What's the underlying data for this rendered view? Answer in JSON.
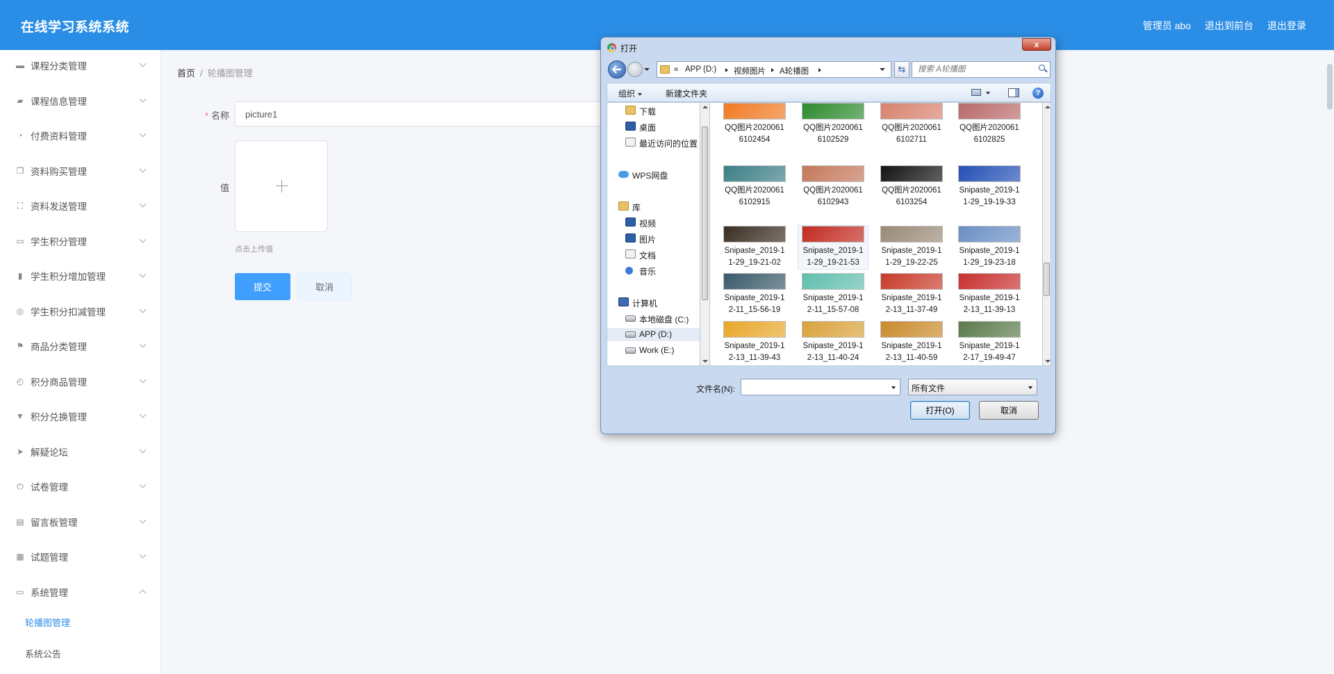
{
  "header": {
    "app_title": "在线学习系统系统",
    "user_label": "管理员 abo",
    "back_to_front": "退出到前台",
    "logout": "退出登录"
  },
  "sidebar": {
    "items": [
      {
        "label": "课程分类管理",
        "icon": "comment-icon"
      },
      {
        "label": "课程信息管理",
        "icon": "thumbs-up-icon"
      },
      {
        "label": "付费资料管理",
        "icon": "dashboard-icon"
      },
      {
        "label": "资料购买管理",
        "icon": "copy-icon"
      },
      {
        "label": "资料发送管理",
        "icon": "fullscreen-icon"
      },
      {
        "label": "学生积分管理",
        "icon": "id-card-icon"
      },
      {
        "label": "学生积分增加管理",
        "icon": "microphone-icon"
      },
      {
        "label": "学生积分扣减管理",
        "icon": "life-ring-icon"
      },
      {
        "label": "商品分类管理",
        "icon": "flag-icon"
      },
      {
        "label": "积分商品管理",
        "icon": "compass-icon"
      },
      {
        "label": "积分兑换管理",
        "icon": "thumbs-down-icon"
      },
      {
        "label": "解疑论坛",
        "icon": "paper-plane-icon"
      },
      {
        "label": "试卷管理",
        "icon": "power-icon"
      },
      {
        "label": "留言板管理",
        "icon": "clipboard-icon"
      },
      {
        "label": "试题管理",
        "icon": "grid-icon"
      },
      {
        "label": "系统管理",
        "icon": "message-icon"
      }
    ],
    "sub_items": [
      "轮播图管理",
      "系统公告"
    ]
  },
  "breadcrumb": {
    "home": "首页",
    "separator": "/",
    "current": "轮播图管理"
  },
  "form": {
    "name_required": "*",
    "name_label": "名称",
    "name_value": "picture1",
    "value_label": "值",
    "upload_hint": "点击上传值",
    "submit": "提交",
    "cancel": "取消"
  },
  "dialog": {
    "title": "打开",
    "close_label": "x",
    "address": {
      "overflow": "«",
      "segments": [
        "APP (D:)",
        "视频图片",
        "A轮播图"
      ]
    },
    "search_placeholder": "搜索 A轮播图",
    "organize": "组织",
    "new_folder": "新建文件夹",
    "help": "?",
    "nav_items": [
      {
        "label": "下载",
        "icon": "ni-folder"
      },
      {
        "label": "桌面",
        "icon": "ni-blue"
      },
      {
        "label": "最近访问的位置",
        "icon": "ni-doc"
      },
      {
        "label": "WPS网盘",
        "icon": "ni-cloud"
      },
      {
        "label": "库",
        "icon": "ni-lib"
      },
      {
        "label": "视频",
        "icon": "ni-blue"
      },
      {
        "label": "图片",
        "icon": "ni-blue"
      },
      {
        "label": "文档",
        "icon": "ni-doc"
      },
      {
        "label": "音乐",
        "icon": "ni-music"
      },
      {
        "label": "计算机",
        "icon": "ni-pc"
      },
      {
        "label": "本地磁盘 (C:)",
        "icon": "ni-drive"
      },
      {
        "label": "APP (D:)",
        "icon": "ni-drive"
      },
      {
        "label": "Work (E:)",
        "icon": "ni-drive"
      }
    ],
    "files": [
      {
        "name": "QQ图片20200616102454",
        "color": "#f07a23"
      },
      {
        "name": "QQ图片20200616102529",
        "color": "#2e8b2e"
      },
      {
        "name": "QQ图片20200616102711",
        "color": "#d7826e"
      },
      {
        "name": "QQ图片20200616102825",
        "color": "#b86a6a"
      },
      {
        "name": "QQ图片20200616102915",
        "color": "#3c7e86"
      },
      {
        "name": "QQ图片20200616102943",
        "color": "#c4785a"
      },
      {
        "name": "QQ图片20200616103254",
        "color": "#121212"
      },
      {
        "name": "Snipaste_2019-11-29_19-19-33",
        "color": "#2350b5"
      },
      {
        "name": "Snipaste_2019-11-29_19-21-02",
        "color": "#3a2e22"
      },
      {
        "name": "Snipaste_2019-11-29_19-21-53",
        "color": "#c22a20"
      },
      {
        "name": "Snipaste_2019-11-29_19-22-25",
        "color": "#9a8a78"
      },
      {
        "name": "Snipaste_2019-11-29_19-23-18",
        "color": "#6a8fc4"
      },
      {
        "name": "Snipaste_2019-12-11_15-56-19",
        "color": "#3a5a6a"
      },
      {
        "name": "Snipaste_2019-12-11_15-57-08",
        "color": "#5fbfae"
      },
      {
        "name": "Snipaste_2019-12-13_11-37-49",
        "color": "#c83a2a"
      },
      {
        "name": "Snipaste_2019-12-13_11-39-13",
        "color": "#c82f2f"
      },
      {
        "name": "Snipaste_2019-12-13_11-39-43",
        "color": "#e8a72a"
      },
      {
        "name": "Snipaste_2019-12-13_11-40-24",
        "color": "#d9a23a"
      },
      {
        "name": "Snipaste_2019-12-13_11-40-59",
        "color": "#c98a2a"
      },
      {
        "name": "Snipaste_2019-12-17_19-49-47",
        "color": "#5a7a4a"
      }
    ],
    "filename_label": "文件名(N):",
    "filename_value": "",
    "filetype": "所有文件",
    "open": "打开(O)",
    "cancel": "取消"
  },
  "colors": {
    "header_bg": "#2b8ee6",
    "primary_button": "#409eff"
  }
}
